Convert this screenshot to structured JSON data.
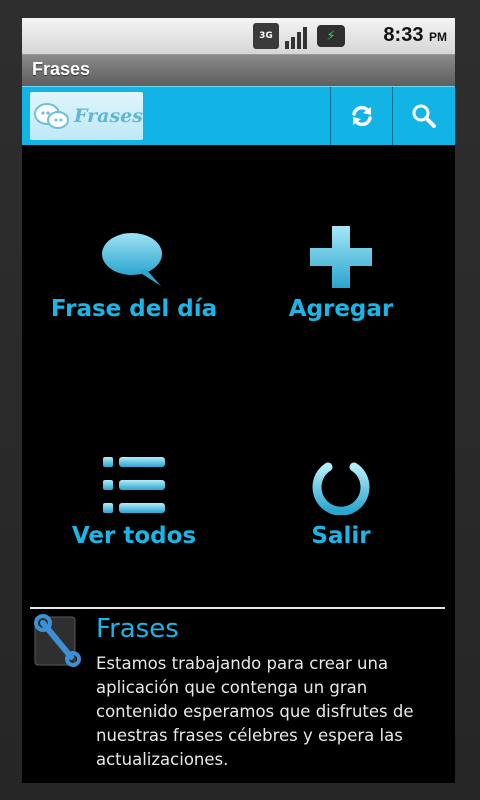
{
  "status_bar": {
    "network_badge": "3G",
    "time": "8:33",
    "ampm": "PM"
  },
  "title_bar": {
    "title": "Frases"
  },
  "action_bar": {
    "logo_text": "Frases",
    "refresh_icon": "refresh-icon",
    "search_icon": "search-icon",
    "bg_color": "#12b4e6"
  },
  "menu": {
    "items": [
      {
        "label": "Frase del día",
        "icon": "speech-bubble-icon"
      },
      {
        "label": "Agregar",
        "icon": "plus-icon"
      },
      {
        "label": "Ver todos",
        "icon": "list-icon"
      },
      {
        "label": "Salir",
        "icon": "power-icon"
      }
    ],
    "accent": "#1ab6e8"
  },
  "notice": {
    "title": "Frases",
    "text": "Estamos trabajando para crear una aplicación que contenga un gran contenido esperamos que disfrutes de nuestras frases célebres y espera las actualizaciones.",
    "icon": "wrench-icon"
  }
}
